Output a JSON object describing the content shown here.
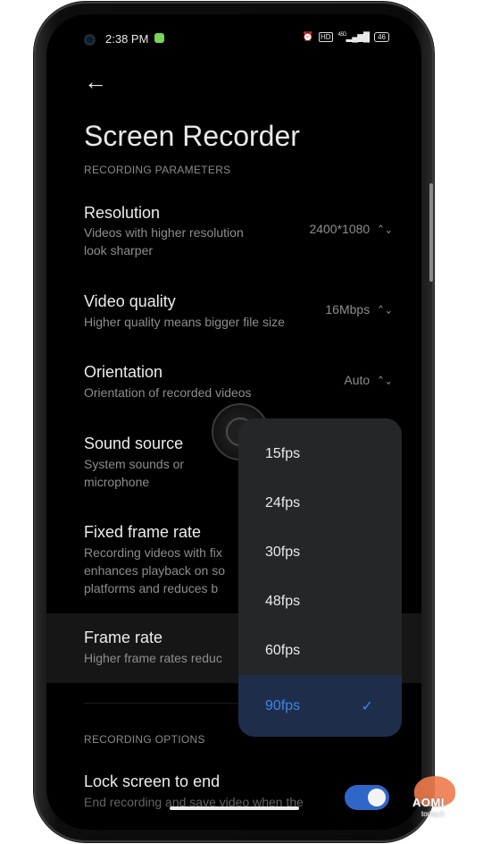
{
  "status_bar": {
    "time": "2:38 PM",
    "icons": [
      "alarm-icon",
      "hd-icon",
      "signal-icon",
      "battery-icon"
    ],
    "network": "4.5G",
    "battery": "46"
  },
  "header": {
    "title": "Screen Recorder"
  },
  "sections": {
    "recording_parameters": "RECORDING PARAMETERS",
    "recording_options": "RECORDING OPTIONS"
  },
  "settings": {
    "resolution": {
      "title": "Resolution",
      "desc_line1": "Videos with higher resolution",
      "desc_line2": "look sharper",
      "value": "2400*1080"
    },
    "video_quality": {
      "title": "Video quality",
      "desc_line1": "Higher quality means bigger file size",
      "value": "16Mbps"
    },
    "orientation": {
      "title": "Orientation",
      "desc_line1": "Orientation of recorded videos",
      "value": "Auto"
    },
    "sound_source": {
      "title": "Sound source",
      "desc_line1": "System sounds or",
      "desc_line2": "microphone"
    },
    "fixed_frame_rate": {
      "title": "Fixed frame rate",
      "desc_line1": "Recording videos with fix",
      "desc_line2": "enhances playback on so",
      "desc_line3": "platforms and reduces b"
    },
    "frame_rate": {
      "title": "Frame rate",
      "desc_line1": "Higher frame rates reduc"
    },
    "lock_screen": {
      "title": "Lock screen to end",
      "desc_line1": "End recording and save video when the",
      "toggle_on": true
    }
  },
  "frame_rate_dropdown": {
    "options": [
      "15fps",
      "24fps",
      "30fps",
      "48fps",
      "60fps",
      "90fps"
    ],
    "selected": "90fps",
    "selected_color": "#3e85ea"
  },
  "logo": {
    "text": "AOMI",
    "sub": "today.it"
  },
  "colors": {
    "accent": "#3e85ea",
    "toggle": "#2f66c8",
    "background": "#000000"
  }
}
